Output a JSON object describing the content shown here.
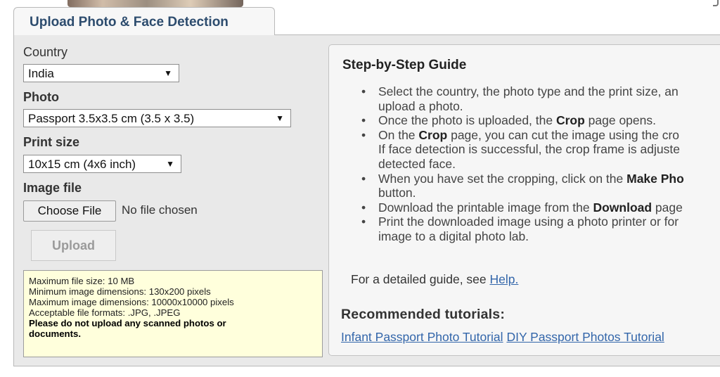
{
  "tab": {
    "title": "Upload Photo & Face Detection"
  },
  "form": {
    "country_label": "Country",
    "country_value": "India",
    "photo_label": "Photo",
    "photo_value": "Passport 3.5x3.5 cm (3.5 x 3.5)",
    "print_size_label": "Print size",
    "print_size_value": "10x15 cm (4x6 inch)",
    "image_file_label": "Image file",
    "choose_file_label": "Choose File",
    "file_status": "No file chosen",
    "upload_label": "Upload"
  },
  "notice": {
    "lines": [
      "Maximum file size: 10 MB",
      "Minimum image dimensions: 130x200 pixels",
      "Maximum image dimensions: 10000x10000 pixels",
      "Acceptable file formats: .JPG, .JPEG"
    ],
    "warning_line1": "Please do not upload any scanned photos or",
    "warning_line2": "documents."
  },
  "guide": {
    "title": "Step-by-Step Guide",
    "items": [
      {
        "line1": "Select the country, the photo type and the print size, an",
        "line2": "upload a photo."
      },
      {
        "a": "Once the photo is uploaded, the ",
        "b": "Crop",
        "c": " page opens."
      },
      {
        "a": "On the ",
        "b": "Crop",
        "c": " page, you can cut the image using the cro",
        "line2": "If face detection is successful, the crop frame is adjuste",
        "line3": "detected face."
      },
      {
        "a": "When you have set the cropping, click on the ",
        "b": "Make Pho",
        "line2": "button."
      },
      {
        "a": "Download the printable image from the ",
        "b": "Download",
        "c": " page"
      },
      {
        "line1": "Print the downloaded image using a photo printer or for",
        "line2": "image to a digital photo lab."
      }
    ],
    "help_text": "For a detailed guide, see ",
    "help_link": "Help.",
    "recommended_title": "Recommended tutorials:",
    "tutorials": [
      "Infant Passport Photo Tutorial",
      "DIY Passport Photos Tutorial"
    ]
  }
}
